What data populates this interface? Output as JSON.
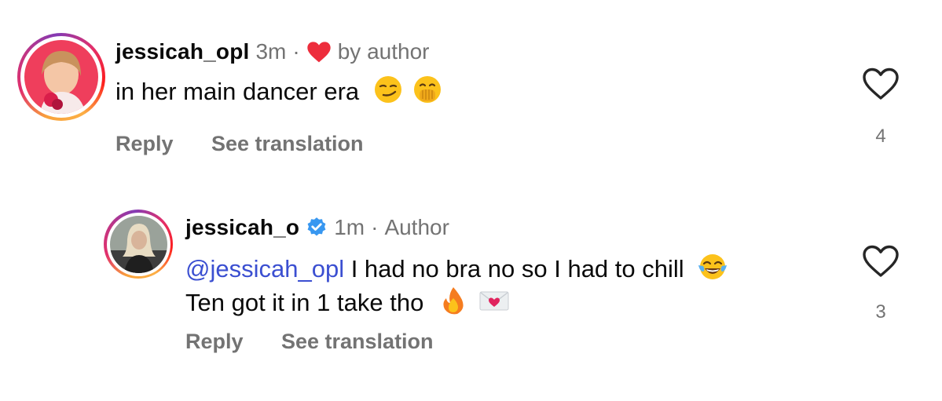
{
  "comments": [
    {
      "username": "jessicah_opl",
      "time": "3m",
      "separator": "·",
      "liked_by_author": "by author",
      "text": "in her main dancer era",
      "emojis": [
        "smirking-face-emoji",
        "face-with-hand-over-mouth-emoji"
      ],
      "reply_label": "Reply",
      "translation_label": "See translation",
      "like_count": "4"
    },
    {
      "username": "jessicah_o",
      "verified": true,
      "time": "1m",
      "separator": "·",
      "author_badge": "Author",
      "mention": "@jessicah_opl",
      "text_line1": "I had no bra no so I had to chill",
      "text_line2": "Ten got it in 1 take tho",
      "emojis": [
        "tears-of-joy-emoji",
        "fire-emoji",
        "love-letter-emoji"
      ],
      "reply_label": "Reply",
      "translation_label": "See translation",
      "like_count": "3"
    }
  ],
  "colors": {
    "heart_red": "#ed2d3c",
    "verified_blue": "#3897f0",
    "mention_blue": "#3b4fd1",
    "meta_gray": "#737373"
  }
}
